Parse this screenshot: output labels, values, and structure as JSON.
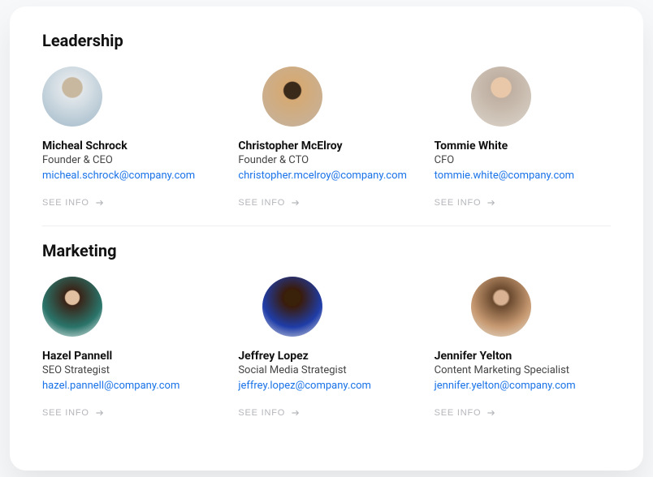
{
  "sections": [
    {
      "title": "Leadership",
      "members": [
        {
          "name": "Micheal Schrock",
          "role": "Founder & CEO",
          "email": "micheal.schrock@company.com",
          "see_info": "SEE INFO"
        },
        {
          "name": "Christopher McElroy",
          "role": "Founder & CTO",
          "email": "christopher.mcelroy@company.com",
          "see_info": "SEE INFO"
        },
        {
          "name": "Tommie White",
          "role": "CFO",
          "email": "tommie.white@company.com",
          "see_info": "SEE INFO"
        }
      ]
    },
    {
      "title": "Marketing",
      "members": [
        {
          "name": "Hazel Pannell",
          "role": "SEO Strategist",
          "email": "hazel.pannell@company.com",
          "see_info": "SEE INFO"
        },
        {
          "name": "Jeffrey Lopez",
          "role": "Social Media Strategist",
          "email": "jeffrey.lopez@company.com",
          "see_info": "SEE INFO"
        },
        {
          "name": "Jennifer Yelton",
          "role": "Content Marketing Specialist",
          "email": "jennifer.yelton@company.com",
          "see_info": "SEE INFO"
        }
      ]
    }
  ]
}
